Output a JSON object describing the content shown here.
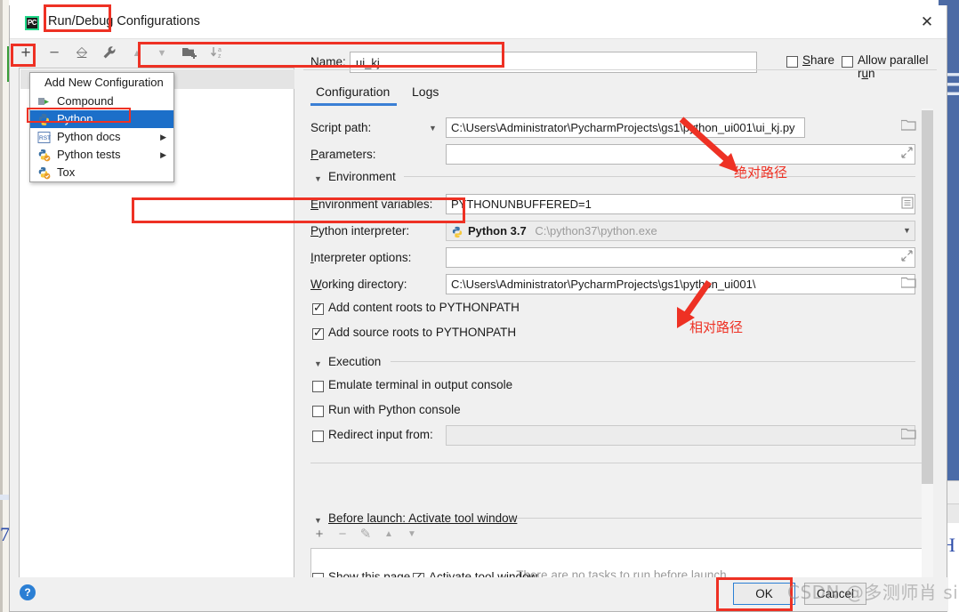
{
  "window": {
    "title": "Run/Debug Configurations",
    "app_icon": "pycharm-icon",
    "close_icon": "close-icon"
  },
  "toolbar": {
    "items": [
      {
        "name": "add-configuration-button",
        "icon": "plus-icon",
        "glyph": "+"
      },
      {
        "name": "remove-configuration-button",
        "icon": "minus-icon",
        "glyph": "−"
      },
      {
        "name": "copy-configuration-button",
        "icon": "copy-icon",
        "glyph": "⎘"
      },
      {
        "name": "edit-templates-button",
        "icon": "wrench-icon",
        "glyph": "🔧"
      },
      {
        "name": "move-up-button",
        "icon": "arrow-up-icon",
        "glyph": "▲"
      },
      {
        "name": "move-down-button",
        "icon": "arrow-down-icon",
        "glyph": "▼"
      },
      {
        "name": "new-folder-button",
        "icon": "folder-plus-icon",
        "glyph": "🗀"
      },
      {
        "name": "sort-configurations-button",
        "icon": "sort-az-icon",
        "glyph": "↓"
      }
    ],
    "sort_label_top": "a",
    "sort_label_bottom": "z"
  },
  "menu": {
    "header": "Add New Configuration",
    "items": [
      {
        "label": "Compound",
        "icon": "compound-icon",
        "selected": false,
        "submenu": false
      },
      {
        "label": "Python",
        "icon": "python-icon",
        "selected": true,
        "submenu": false
      },
      {
        "label": "Python docs",
        "icon": "rst-icon",
        "selected": false,
        "submenu": true
      },
      {
        "label": "Python tests",
        "icon": "python-tests-icon",
        "selected": false,
        "submenu": true
      },
      {
        "label": "Tox",
        "icon": "tox-icon",
        "selected": false,
        "submenu": false
      }
    ],
    "submenu_arrow": "▶"
  },
  "header": {
    "name_label": "Name:",
    "name_value": "ui_kj",
    "share_label": "Share",
    "share_checked": false,
    "allow_parallel_label": "Allow parallel run",
    "allow_parallel_checked": false
  },
  "tabs": [
    {
      "label": "Configuration",
      "active": true
    },
    {
      "label": "Logs",
      "active": false
    }
  ],
  "form": {
    "script_path_label": "Script path:",
    "script_path_value": "C:\\Users\\Administrator\\PycharmProjects\\gs1\\python_ui001\\ui_kj.py",
    "parameters_label": "Parameters:",
    "parameters_value": "",
    "environment_section": "Environment",
    "env_vars_label": "Environment variables:",
    "env_vars_value": "PYTHONUNBUFFERED=1",
    "interpreter_label": "Python interpreter:",
    "interpreter_value": "Python 3.7",
    "interpreter_path": "C:\\python37\\python.exe",
    "interpreter_options_label": "Interpreter options:",
    "interpreter_options_value": "",
    "working_dir_label": "Working directory:",
    "working_dir_value": "C:\\Users\\Administrator\\PycharmProjects\\gs1\\python_ui001\\",
    "add_content_roots_label": "Add content roots to PYTHONPATH",
    "add_content_roots_checked": true,
    "add_source_roots_label": "Add source roots to PYTHONPATH",
    "add_source_roots_checked": true,
    "execution_section": "Execution",
    "emulate_terminal_label": "Emulate terminal in output console",
    "emulate_terminal_checked": false,
    "run_python_console_label": "Run with Python console",
    "run_python_console_checked": false,
    "redirect_input_label": "Redirect input from:",
    "redirect_input_checked": false,
    "redirect_input_value": ""
  },
  "before_launch": {
    "section": "Before launch: Activate tool window",
    "empty_text": "There are no tasks to run before launch",
    "buttons": [
      {
        "name": "add-task-button",
        "icon": "plus-icon",
        "glyph": "+"
      },
      {
        "name": "remove-task-button",
        "icon": "minus-icon",
        "glyph": "−"
      },
      {
        "name": "edit-task-button",
        "icon": "pencil-icon",
        "glyph": "✎"
      },
      {
        "name": "task-move-up-button",
        "icon": "arrow-up-icon",
        "glyph": "▲"
      },
      {
        "name": "task-move-down-button",
        "icon": "arrow-down-icon",
        "glyph": "▼"
      }
    ]
  },
  "footer": {
    "show_this_page_label": "Show this page",
    "show_this_page_checked": false,
    "activate_tool_window_label": "Activate tool window",
    "activate_tool_window_checked": true,
    "ok_label": "OK",
    "cancel_label": "Cancel",
    "help_icon": "question-mark-icon",
    "help_glyph": "?"
  },
  "annotations": [
    {
      "text": "绝对路径",
      "meaning": "absolute-path"
    },
    {
      "text": "相对路径",
      "meaning": "relative-path"
    }
  ],
  "watermark": "CSDN @多测师肖 sir",
  "colors": {
    "highlight_red": "#ee3124",
    "selection_blue": "#1c6fc9",
    "tab_accent": "#3a7fd5",
    "help_blue": "#2b7fd4"
  }
}
